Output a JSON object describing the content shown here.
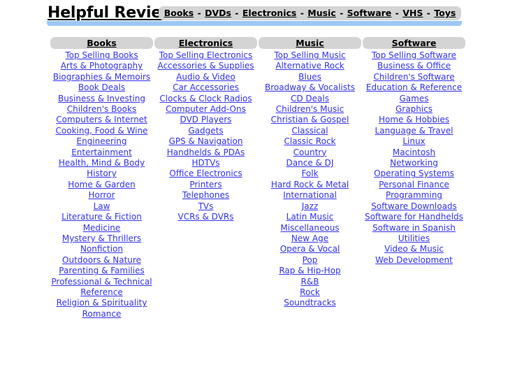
{
  "site": {
    "title": "Helpful Reviews",
    "accent_blue": "#9cc8f5",
    "bar_gray": "#d4d4d4",
    "link_blue": "#3333ee"
  },
  "topnav": {
    "separator": "-",
    "items": [
      {
        "label": "Books"
      },
      {
        "label": "DVDs"
      },
      {
        "label": "Electronics"
      },
      {
        "label": "Music"
      },
      {
        "label": "Software"
      },
      {
        "label": "VHS"
      },
      {
        "label": "Toys"
      }
    ]
  },
  "columns": [
    {
      "heading": "Books",
      "links": [
        "Top Selling Books",
        "Arts & Photography",
        "Biographies & Memoirs",
        "Book Deals",
        "Business & Investing",
        "Children's Books",
        "Computers & Internet",
        "Cooking, Food & Wine",
        "Engineering",
        "Entertainment",
        "Health, Mind & Body",
        "History",
        "Home & Garden",
        "Horror",
        "Law",
        "Literature & Fiction",
        "Medicine",
        "Mystery & Thrillers",
        "Nonfiction",
        "Outdoors & Nature",
        "Parenting & Families",
        "Professional & Technical",
        "Reference",
        "Religion & Spirituality",
        "Romance"
      ]
    },
    {
      "heading": "Electronics",
      "links": [
        "Top Selling Electronics",
        "Accessories & Supplies",
        "Audio & Video",
        "Car Accessories",
        "Clocks & Clock Radios",
        "Computer Add-Ons",
        "DVD Players",
        "Gadgets",
        "GPS & Navigation",
        "Handhelds & PDAs",
        "HDTVs",
        "Office Electronics",
        "Printers",
        "Telephones",
        "TVs",
        "VCRs & DVRs"
      ]
    },
    {
      "heading": "Music",
      "links": [
        "Top Selling Music",
        "Alternative Rock",
        "Blues",
        "Broadway & Vocalists",
        "CD Deals",
        "Children's Music",
        "Christian & Gospel",
        "Classical",
        "Classic Rock",
        "Country",
        "Dance & DJ",
        "Folk",
        "Hard Rock & Metal",
        "International",
        "Jazz",
        "Latin Music",
        "Miscellaneous",
        "New Age",
        "Opera & Vocal",
        "Pop",
        "Rap & Hip-Hop",
        "R&B",
        "Rock",
        "Soundtracks"
      ]
    },
    {
      "heading": "Software",
      "links": [
        "Top Selling Software",
        "Business & Office",
        "Children's Software",
        "Education & Reference",
        "Games",
        "Graphics",
        "Home & Hobbies",
        "Language & Travel",
        "Linux",
        "Macintosh",
        "Networking",
        "Operating Systems",
        "Personal Finance",
        "Programming",
        "Software Downloads",
        "Software for Handhelds",
        "Software in Spanish",
        "Utilities",
        "Video & Music",
        "Web Development"
      ]
    }
  ]
}
